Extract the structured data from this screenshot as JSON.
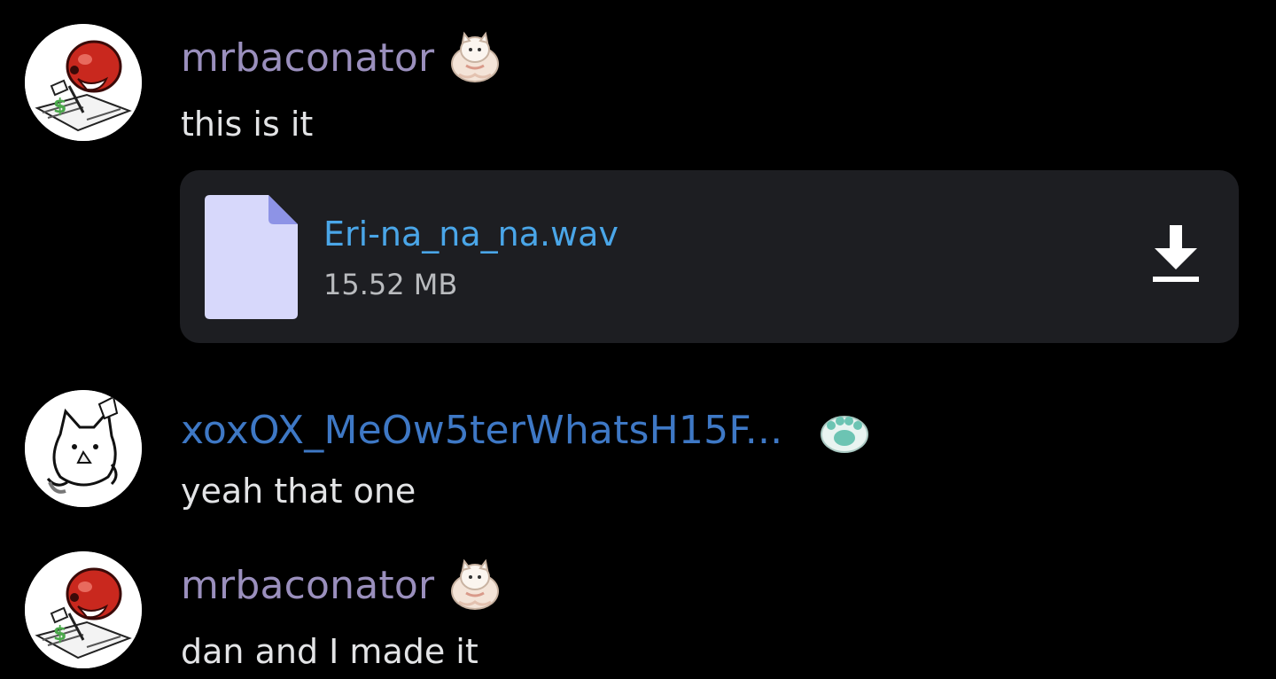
{
  "messages": [
    {
      "username": "mrbaconator",
      "username_color": "#9a8fbd",
      "text": "this is it",
      "avatar_icon": "red-character-with-money-avatar",
      "badge_icon": "fluffy-cat-badge-icon",
      "attachment": {
        "file_icon": "document-file-icon",
        "file_name": "Eri-na_na_na.wav",
        "file_size": "15.52 MB",
        "download_icon": "download-icon",
        "name_color": "#4aa6e8"
      }
    },
    {
      "username": "xoxOX_MeOw5terWhatsH15F...",
      "username_color": "#3e78c5",
      "text": "yeah that one",
      "avatar_icon": "white-cat-avatar",
      "badge_icon": "paw-badge-icon"
    },
    {
      "username": "mrbaconator",
      "username_color": "#9a8fbd",
      "text": "dan and I made it",
      "avatar_icon": "red-character-with-money-avatar",
      "badge_icon": "fluffy-cat-badge-icon"
    }
  ],
  "colors": {
    "background": "#000000",
    "attachment_bg": "#1d1e22",
    "file_icon": "#d7d8fb",
    "file_icon_fold": "#8d93e6",
    "message_text": "#e3e4e6"
  }
}
